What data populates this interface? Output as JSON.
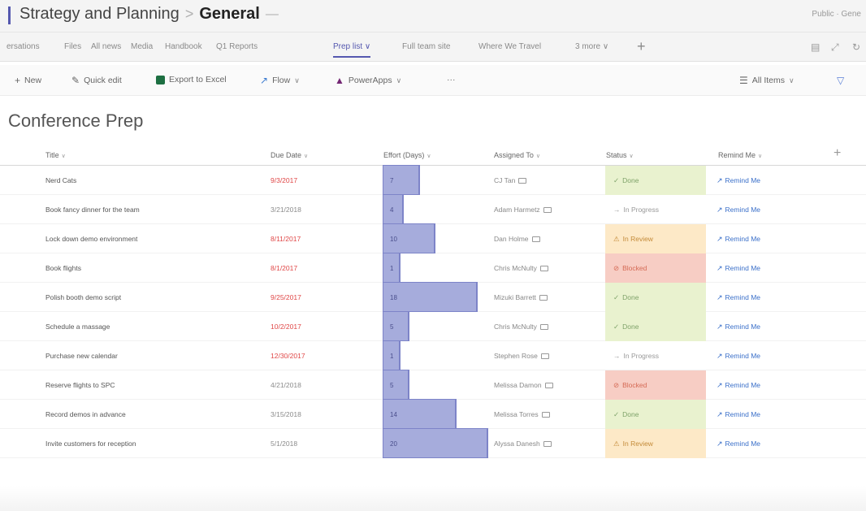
{
  "header": {
    "team": "Strategy and Planning",
    "separator": ">",
    "channel": "General",
    "channel_more": "—",
    "right_text": "Public · Gene"
  },
  "tabs": [
    {
      "label": "ersations"
    },
    {
      "label": "Files"
    },
    {
      "label": "All news"
    },
    {
      "label": "Media"
    },
    {
      "label": "Handbook"
    },
    {
      "label": "Q1 Reports"
    },
    {
      "label": "Prep list ∨"
    },
    {
      "label": "Full team site"
    },
    {
      "label": "Where We Travel"
    },
    {
      "label": "3 more ∨"
    }
  ],
  "tab_add": "+",
  "commands": {
    "new": "New",
    "quick_edit": "Quick edit",
    "export": "Export to Excel",
    "flow": "Flow",
    "powerapps": "PowerApps",
    "more": "···",
    "view": "All Items"
  },
  "page_title": "Conference Prep",
  "columns": {
    "title": "Title",
    "due": "Due Date",
    "effort": "Effort (Days)",
    "assigned": "Assigned To",
    "status": "Status",
    "remind": "Remind Me"
  },
  "effort_max": 20,
  "rows": [
    {
      "title": "Nerd Cats",
      "due": "9/3/2017",
      "overdue": true,
      "effort": 7,
      "assigned": "CJ Tan",
      "status": "Done",
      "status_type": "done",
      "remind": "Remind Me"
    },
    {
      "title": "Book fancy dinner for the team",
      "due": "3/21/2018",
      "overdue": false,
      "effort": 4,
      "assigned": "Adam Harmetz",
      "status": "In Progress",
      "status_type": "progress",
      "remind": "Remind Me"
    },
    {
      "title": "Lock down demo environment",
      "due": "8/11/2017",
      "overdue": true,
      "effort": 10,
      "assigned": "Dan Holme",
      "status": "In Review",
      "status_type": "review",
      "remind": "Remind Me"
    },
    {
      "title": "Book flights",
      "due": "8/1/2017",
      "overdue": true,
      "effort": 1,
      "assigned": "Chris McNulty",
      "status": "Blocked",
      "status_type": "blocked",
      "remind": "Remind Me"
    },
    {
      "title": "Polish booth demo script",
      "due": "9/25/2017",
      "overdue": true,
      "effort": 18,
      "assigned": "Mizuki Barrett",
      "status": "Done",
      "status_type": "done",
      "remind": "Remind Me"
    },
    {
      "title": "Schedule a massage",
      "due": "10/2/2017",
      "overdue": true,
      "effort": 5,
      "assigned": "Chris McNulty",
      "status": "Done",
      "status_type": "done",
      "remind": "Remind Me"
    },
    {
      "title": "Purchase new calendar",
      "due": "12/30/2017",
      "overdue": true,
      "effort": 1,
      "assigned": "Stephen Rose",
      "status": "In Progress",
      "status_type": "progress",
      "remind": "Remind Me"
    },
    {
      "title": "Reserve flights to SPC",
      "due": "4/21/2018",
      "overdue": false,
      "effort": 5,
      "assigned": "Melissa Damon",
      "status": "Blocked",
      "status_type": "blocked",
      "remind": "Remind Me"
    },
    {
      "title": "Record demos in advance",
      "due": "3/15/2018",
      "overdue": false,
      "effort": 14,
      "assigned": "Melissa Torres",
      "status": "Done",
      "status_type": "done",
      "remind": "Remind Me"
    },
    {
      "title": "Invite customers for reception",
      "due": "5/1/2018",
      "overdue": false,
      "effort": 20,
      "assigned": "Alyssa Danesh",
      "status": "In Review",
      "status_type": "review",
      "remind": "Remind Me"
    }
  ],
  "colors": {
    "accent": "#5558af",
    "overdue": "#e04848",
    "effort_bar": "#a6acdc",
    "done": "#e9f2cf",
    "review": "#fde9c7",
    "blocked": "#f7cdc4",
    "link": "#3a6fc9"
  },
  "status_icons": {
    "done": "✓",
    "progress": "→",
    "review": "⚠",
    "blocked": "⊘"
  }
}
